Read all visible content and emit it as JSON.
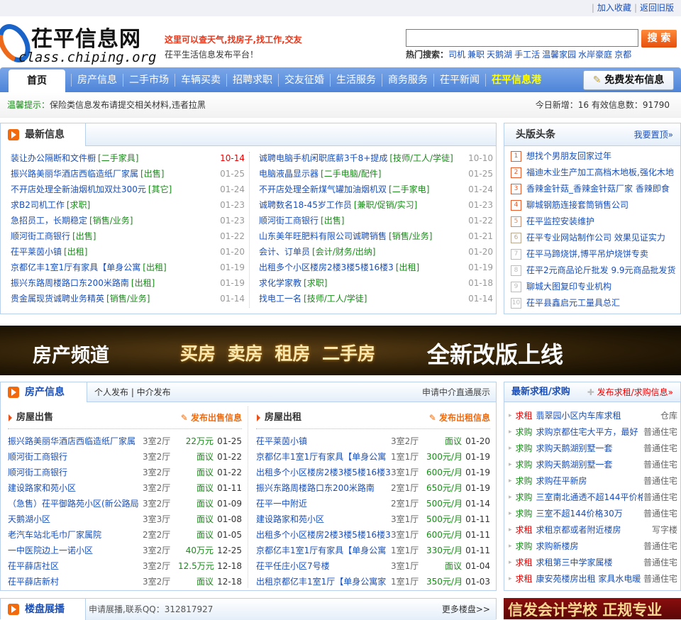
{
  "topbar": {
    "links": [
      "加入收藏",
      "返回旧版"
    ]
  },
  "header": {
    "logo_title": "茌平信息网",
    "logo_url": "class.chiping.org",
    "slogan": "这里可以查天气,找房子,找工作,交友",
    "subtitle": "茌平生活信息发布平台！",
    "search_value": "",
    "search_button": "搜 索",
    "hot_label": "热门搜索：",
    "hot": [
      "司机",
      "兼职",
      "天鹅湖",
      "手工活",
      "温馨家园",
      "水岸豪庭",
      "京都"
    ]
  },
  "nav": {
    "home": "首页",
    "items": [
      "房产信息",
      "二手市场",
      "车辆买卖",
      "招聘求职",
      "交友征婚",
      "生活服务",
      "商务服务",
      "茌平新闻"
    ],
    "highlight": "茌平信息港",
    "publish": "免费发布信息"
  },
  "notice": {
    "label": "温馨提示：",
    "text": "保险类信息发布请提交相关材料,违者拉黑",
    "stats": "今日新增：16 有效信息数：91790"
  },
  "latest": {
    "title": "最新信息",
    "left": [
      {
        "t": "装让办公隔断和文件橱",
        "c": "[二手家具]",
        "d": "10-14",
        "hot": true
      },
      {
        "t": "振兴路美丽华酒店西临造纸厂家属",
        "c": "[出售]",
        "d": "01-25"
      },
      {
        "t": "不开店处理全新油烟机加双灶300元",
        "c": "[其它]",
        "d": "01-24"
      },
      {
        "t": "求B2司机工作",
        "c": "[求职]",
        "d": "01-23"
      },
      {
        "t": "急招员工，长期稳定",
        "c": "[销售/业务]",
        "d": "01-23"
      },
      {
        "t": "顺河街工商银行",
        "c": "[出售]",
        "d": "01-22"
      },
      {
        "t": "茌平莱茵小镇",
        "c": "[出租]",
        "d": "01-20"
      },
      {
        "t": "京都亿丰1室1厅有家具【单身公寓",
        "c": "[出租]",
        "d": "01-19"
      },
      {
        "t": "振兴东路周楼路口东200米路南",
        "c": "[出租]",
        "d": "01-19"
      },
      {
        "t": "贵金属现货诚聘业务精英",
        "c": "[销售/业务]",
        "d": "01-14"
      }
    ],
    "right": [
      {
        "t": "诚聘电脑手机闲职底薪3千8+提成",
        "c": "[技师/工人/学徒]",
        "d": "10-10"
      },
      {
        "t": "电脑液晶显示器",
        "c": "[二手电脑/配件]",
        "d": "01-25"
      },
      {
        "t": "不开店处理全新煤气罐加油烟机双",
        "c": "[二手家电]",
        "d": "01-24"
      },
      {
        "t": "诚聘数名18-45岁工作员",
        "c": "[兼职/促销/实习]",
        "d": "01-23"
      },
      {
        "t": "顺河街工商银行",
        "c": "[出售]",
        "d": "01-22"
      },
      {
        "t": "山东美年旺肥料有限公司诚聘销售",
        "c": "[销售/业务]",
        "d": "01-21"
      },
      {
        "t": "会计、订单员",
        "c": "[会计/财务/出纳]",
        "d": "01-20"
      },
      {
        "t": "出租多个小区楼房2楼3楼5楼16楼3",
        "c": "[出租]",
        "d": "01-19"
      },
      {
        "t": "求化学家教",
        "c": "[求职]",
        "d": "01-18"
      },
      {
        "t": "找电工一名",
        "c": "[技师/工人/学徒]",
        "d": "01-14"
      }
    ]
  },
  "headlines": {
    "title": "头版头条",
    "more": "我要置顶»",
    "items": [
      "想找个男朋友回家过年",
      "福迪木业生产加工高档木地板,强化木地",
      "香辣金针菇_香辣金针菇厂家 香辣即食",
      "聊城钢筋连接套筒销售公司",
      "茌平监控安装维护",
      "茌平专业网站制作公司 效果见证实力",
      "茌平马蹄烧饼,博平吊炉烧饼专卖",
      "茌平2元商品论斤批发 9.9元商品批发货",
      "聊城大图复印专业机构",
      "茌平县鑫启元工量具总汇"
    ],
    "colors": [
      "#e85a2a",
      "#e85a2a",
      "#e85a2a",
      "#e85a2a",
      "#c89070",
      "#b8a890",
      "#bbbbbb",
      "#bbbbbb",
      "#bbbbbb",
      "#bbbbbb"
    ]
  },
  "banner": {
    "a": "房产频道",
    "b": "买房 卖房 租房 二手房",
    "c": "全新改版上线"
  },
  "house": {
    "title": "房产信息",
    "sub": "个人发布 | 中介发布",
    "apply": "申请中介直通展示",
    "sale": {
      "title": "房屋出售",
      "post": "发布出售信息",
      "rows": [
        [
          "振兴路美丽华酒店西临造纸厂家属",
          "3室2厅",
          "22万元",
          "01-25"
        ],
        [
          "顺河街工商银行",
          "3室2厅",
          "面议",
          "01-22"
        ],
        [
          "顺河街工商银行",
          "3室2厅",
          "面议",
          "01-22"
        ],
        [
          "建设路家和苑小区",
          "3室2厅",
          "面议",
          "01-11"
        ],
        [
          "（急售）茌平御路苑小区(新公路局",
          "3室2厅",
          "面议",
          "01-09"
        ],
        [
          "天鹅湖小区",
          "3室3厅",
          "面议",
          "01-08"
        ],
        [
          "老汽车站北毛巾厂家属院",
          "2室2厅",
          "面议",
          "01-05"
        ],
        [
          "一中医院边上一诺小区",
          "3室2厅",
          "40万元",
          "12-25"
        ],
        [
          "茌平薛店社区",
          "3室2厅",
          "12.5万元",
          "12-18"
        ],
        [
          "茌平薛店新村",
          "3室2厅",
          "面议",
          "12-18"
        ]
      ]
    },
    "rent": {
      "title": "房屋出租",
      "post": "发布出租信息",
      "rows": [
        [
          "茌平莱茵小镇",
          "3室2厅",
          "面议",
          "01-20"
        ],
        [
          "京都亿丰1室1厅有家具【单身公寓",
          "1室1厅",
          "300元/月",
          "01-19"
        ],
        [
          "出租多个小区楼房2楼3楼5楼16楼3",
          "3室1厅",
          "600元/月",
          "01-19"
        ],
        [
          "振兴东路周楼路口东200米路南",
          "2室1厅",
          "650元/月",
          "01-19"
        ],
        [
          "茌平一中附近",
          "2室1厅",
          "500元/月",
          "01-14"
        ],
        [
          "建设路家和苑小区",
          "3室1厅",
          "500元/月",
          "01-11"
        ],
        [
          "出租多个小区楼房2楼3楼5楼16楼3",
          "3室1厅",
          "600元/月",
          "01-11"
        ],
        [
          "京都亿丰1室1厅有家具【单身公寓",
          "1室1厅",
          "330元/月",
          "01-11"
        ],
        [
          "茌平任庄小区7号楼",
          "3室1厅",
          "面议",
          "01-04"
        ],
        [
          "出租京都亿丰1室1厅【单身公寓家",
          "1室1厅",
          "350元/月",
          "01-03"
        ]
      ]
    }
  },
  "wanted": {
    "title": "最新求租/求购",
    "post": "发布求租/求购信息»",
    "rows": [
      [
        "求租",
        "翡翠园小区内车库求租",
        "仓库"
      ],
      [
        "求购",
        "求购京都住宅大平方，最好",
        "普通住宅"
      ],
      [
        "求购",
        "求购天鹅湖别墅一套",
        "普通住宅"
      ],
      [
        "求购",
        "求购天鹅湖别墅一套",
        "普通住宅"
      ],
      [
        "求购",
        "求购茌平新房",
        "普通住宅"
      ],
      [
        "求购",
        "三室南北通透不超144平价格",
        "普通住宅"
      ],
      [
        "求购",
        "三室不超144价格30万",
        "普通住宅"
      ],
      [
        "求租",
        "求租京都或者附近楼房",
        "写字楼"
      ],
      [
        "求购",
        "求购新楼房",
        "普通住宅"
      ],
      [
        "求租",
        "求租第三中学家属楼",
        "普通住宅"
      ],
      [
        "求租",
        "康安苑楼房出租 家具水电暖",
        "普通住宅"
      ]
    ]
  },
  "loupan": {
    "title": "楼盘展播",
    "text": "申请展播,联系QQ：312817927",
    "more": "更多楼盘>>"
  },
  "ad": {
    "text": "信发会计学校 正规专业"
  }
}
